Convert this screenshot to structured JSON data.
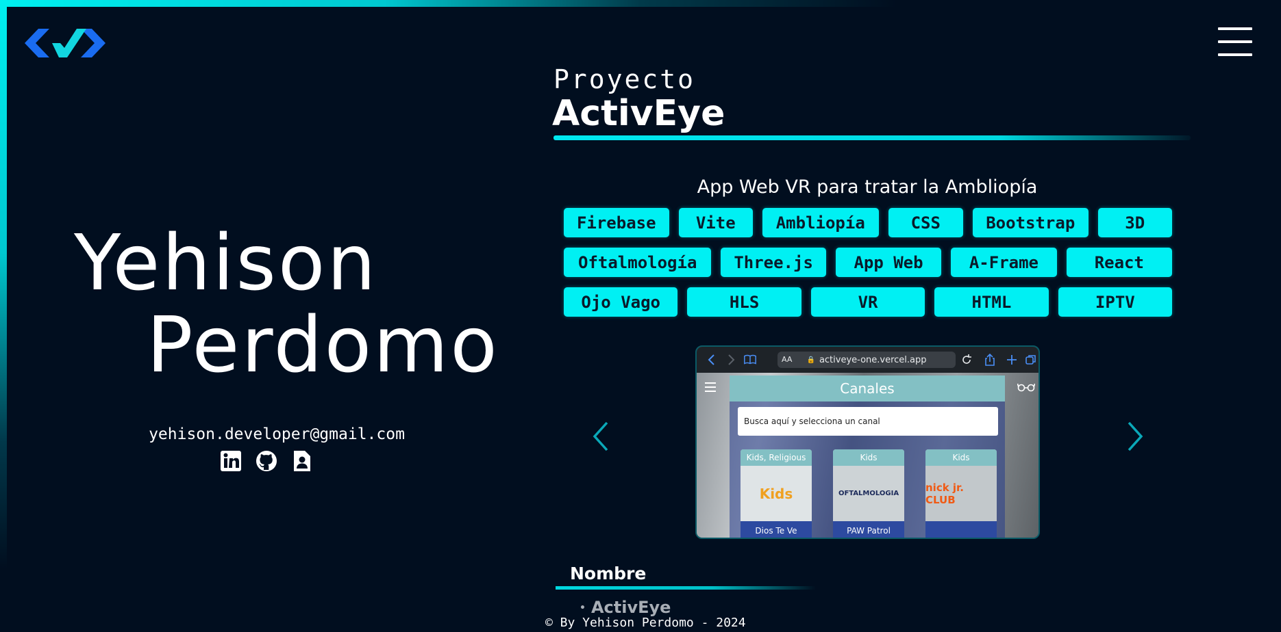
{
  "colors": {
    "background": "#010e1f",
    "accent": "#00f0f3",
    "tag_text": "#0a1a2a",
    "logo_blue": "#1a6cf0",
    "logo_cyan": "#12d6e0"
  },
  "header": {
    "logo_icon": "code-brackets-logo-icon",
    "menu_icon": "hamburger-menu-icon"
  },
  "profile": {
    "first_name": "Yehison",
    "last_name": "Perdomo",
    "email": "yehison.developer@gmail.com",
    "social_icons": [
      "linkedin-icon",
      "github-icon",
      "resume-icon"
    ]
  },
  "project": {
    "label": "Proyecto",
    "title": "ActivEye",
    "subtitle": "App Web VR para tratar la Ambliopía",
    "tags_row1": [
      "Firebase",
      "Vite",
      "Ambliopía",
      "CSS",
      "Bootstrap",
      "3D"
    ],
    "tags_row2": [
      "Oftalmología",
      "Three.js",
      "App Web",
      "A-Frame",
      "React"
    ],
    "tags_row3": [
      "Ojo Vago",
      "HLS",
      "VR",
      "HTML",
      "IPTV"
    ]
  },
  "carousel": {
    "prev_icon": "chevron-left-icon",
    "next_icon": "chevron-right-icon",
    "screenshot": {
      "aa_label": "AA",
      "url": "activeye-one.vercel.app",
      "header": "Canales",
      "search_placeholder": "Busca aquí y selecciona un canal",
      "cards": [
        {
          "category": "Kids, Religious",
          "logo_text": "Kids",
          "name": "Dios Te Ve"
        },
        {
          "category": "Kids",
          "logo_text": "OFTALMOLOGIA",
          "name": "PAW Patrol"
        },
        {
          "category": "Kids",
          "logo_text": "nick jr. CLUB",
          "name": ""
        }
      ]
    }
  },
  "details": {
    "field_label": "Nombre",
    "field_value": "ActivEye"
  },
  "footer": {
    "text": "© By Yehison Perdomo - 2024"
  }
}
